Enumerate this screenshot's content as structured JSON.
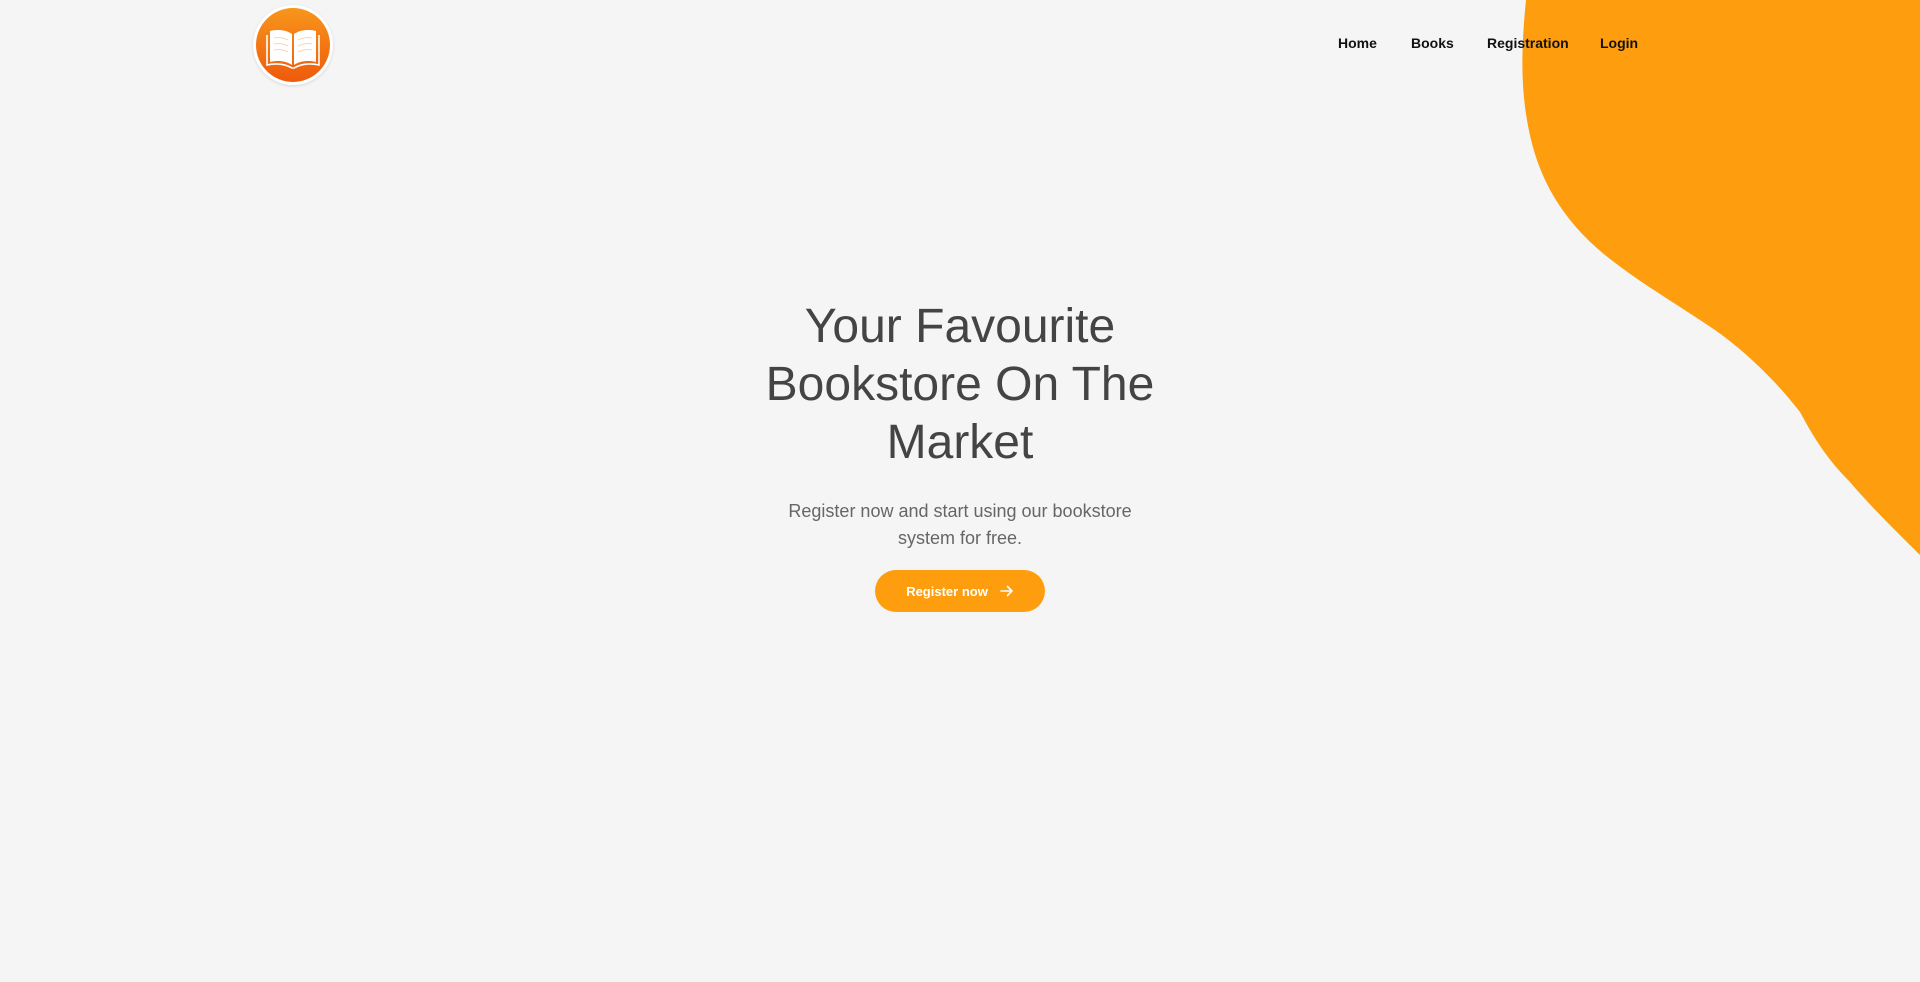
{
  "nav": {
    "items": [
      {
        "label": "Home"
      },
      {
        "label": "Books"
      },
      {
        "label": "Registration"
      },
      {
        "label": "Login"
      }
    ]
  },
  "hero": {
    "title_line1": "Your Favourite",
    "title_line2": "Bookstore On The",
    "title_line3": "Market",
    "subtitle_line1": "Register now and start using our bookstore",
    "subtitle_line2": "system for free.",
    "cta_label": "Register now"
  },
  "colors": {
    "accent": "#fe9e0e",
    "background": "#f5f5f5",
    "heading": "#444444",
    "logo_gradient_top": "#f8961b",
    "logo_gradient_bottom": "#ee5a0c"
  },
  "icons": {
    "logo": "open-book-icon",
    "cta": "arrow-right-icon"
  }
}
